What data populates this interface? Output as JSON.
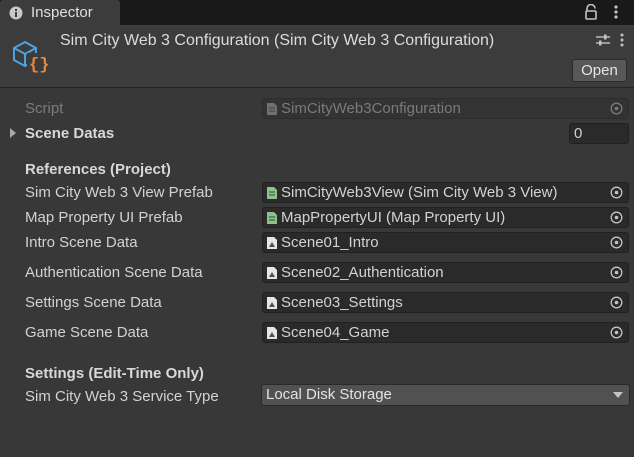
{
  "tab": {
    "label": "Inspector",
    "icon": "info-icon"
  },
  "header": {
    "title": "Sim City Web 3 Configuration (Sim City Web 3 Configuration)",
    "open_label": "Open",
    "icon": "scriptable-object-icon"
  },
  "script": {
    "label": "Script",
    "value": "SimCityWeb3Configuration",
    "icon": "script-file-icon"
  },
  "scene_datas": {
    "label": "Scene Datas",
    "count": "0"
  },
  "references": {
    "heading": "References (Project)",
    "rows": [
      {
        "label": "Sim City Web 3 View Prefab",
        "value": "SimCityWeb3View (Sim City Web 3 View)",
        "icon": "script-file-icon"
      },
      {
        "label": "Map Property UI Prefab",
        "value": "MapPropertyUI (Map Property UI)",
        "icon": "script-file-icon"
      },
      {
        "label": "Intro Scene Data",
        "value": "Scene01_Intro",
        "icon": "scene-asset-icon"
      },
      {
        "label": "Authentication Scene Data",
        "value": "Scene02_Authentication",
        "icon": "scene-asset-icon"
      },
      {
        "label": "Settings Scene Data",
        "value": "Scene03_Settings",
        "icon": "scene-asset-icon"
      },
      {
        "label": "Game Scene Data",
        "value": "Scene04_Game",
        "icon": "scene-asset-icon"
      }
    ]
  },
  "settings": {
    "heading": "Settings (Edit-Time Only)",
    "service_type_label": "Sim City Web 3 Service Type",
    "service_type_value": "Local Disk Storage"
  },
  "colors": {
    "panel": "#383838",
    "field": "#2a2a2a",
    "icon_blue": "#4ba3e3",
    "icon_orange": "#f0853a"
  }
}
